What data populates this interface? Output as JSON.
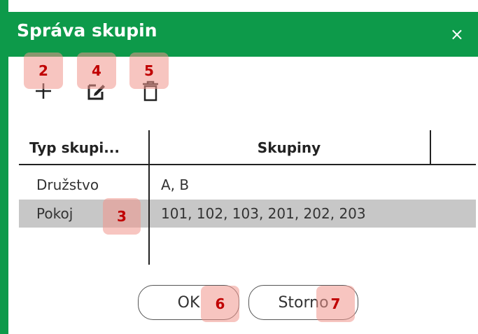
{
  "dialog": {
    "title": "Správa skupin",
    "close_glyph": "×",
    "accent_color": "#0d9a4a"
  },
  "toolbar": {
    "add_icon": "plus-icon",
    "edit_icon": "edit-icon",
    "delete_icon": "trash-icon"
  },
  "table": {
    "columns": [
      "Typ skupi...",
      "Skupiny"
    ],
    "rows": [
      {
        "type": "Družstvo",
        "groups": "A, B",
        "selected": false
      },
      {
        "type": "Pokoj",
        "groups": "101, 102, 103, 201, 202, 203",
        "selected": true
      }
    ]
  },
  "buttons": {
    "ok": "OK",
    "cancel": "Storno"
  },
  "badges": [
    "2",
    "4",
    "5",
    "3",
    "6",
    "7"
  ]
}
